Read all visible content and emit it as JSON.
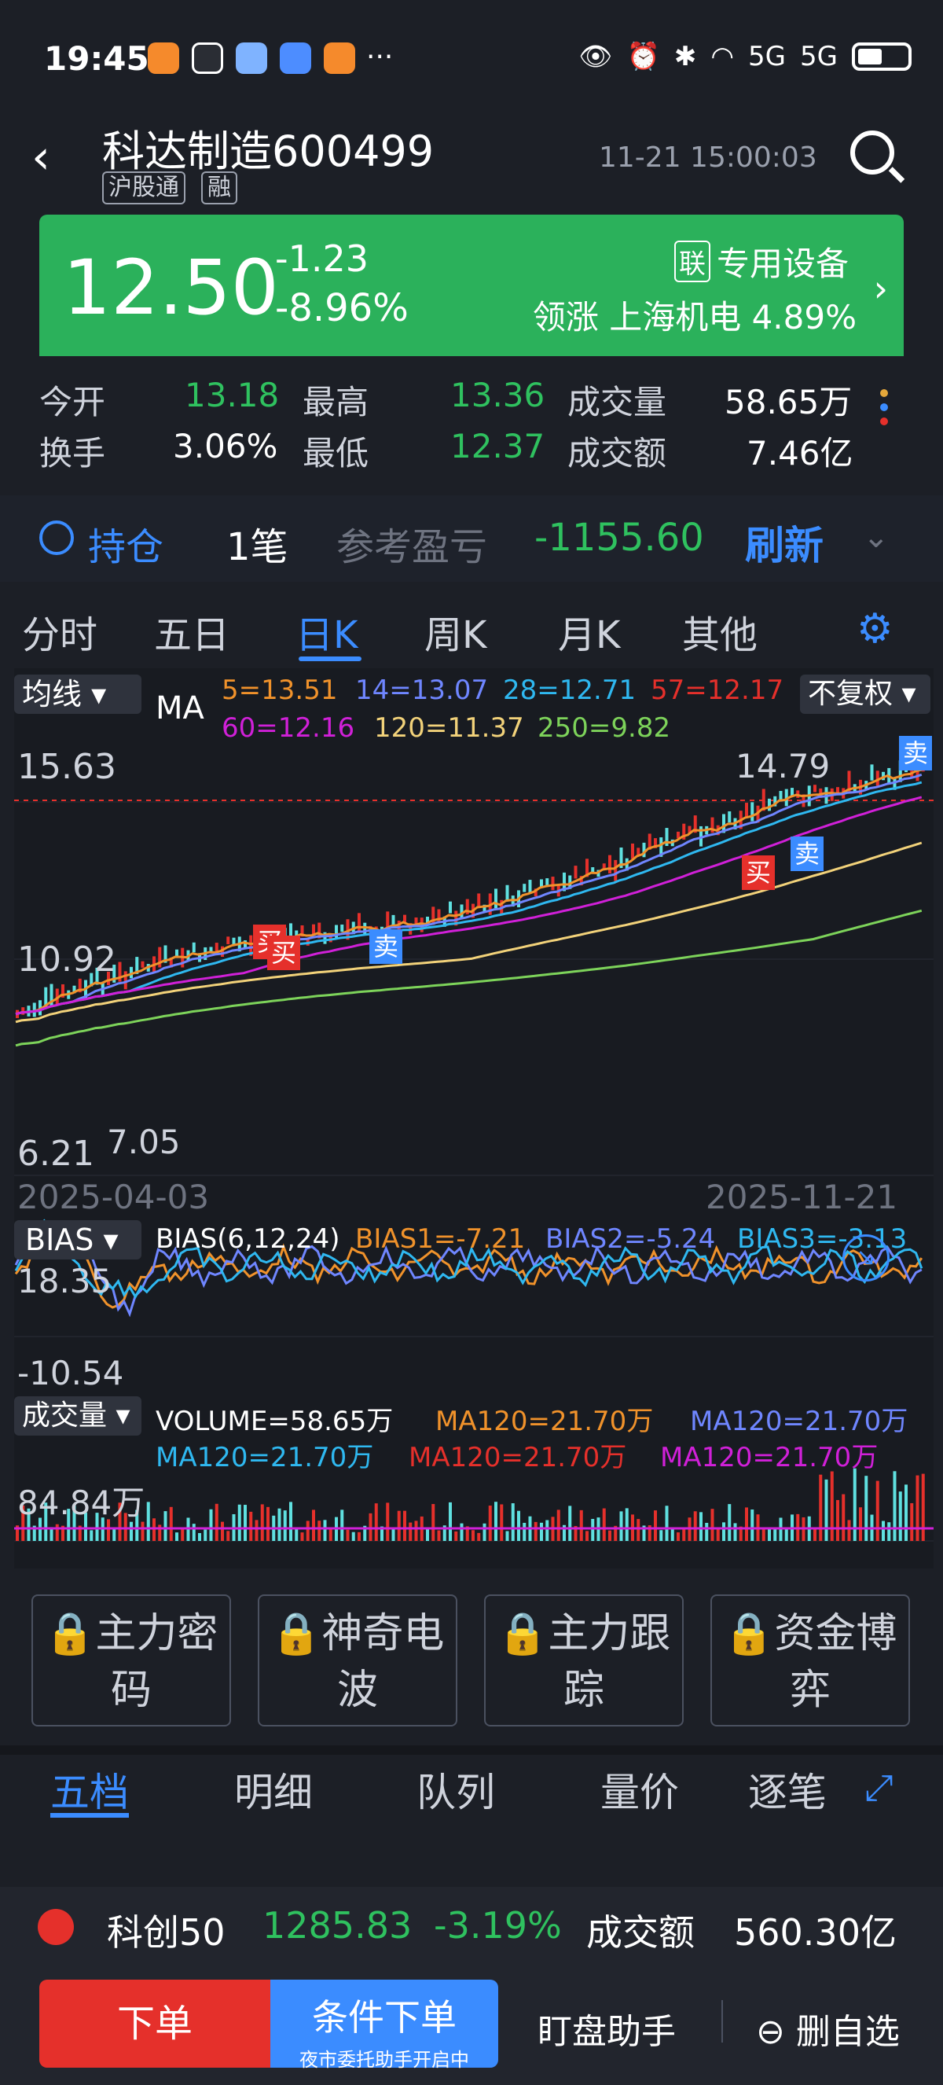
{
  "status": {
    "time": "19:45",
    "net": "5G"
  },
  "header": {
    "name": "科达制造600499",
    "tag1": "沪股通",
    "tag2": "融",
    "datetime": "11-21 15:00:03"
  },
  "quote": {
    "price": "12.50",
    "change": "-1.23",
    "pct": "-8.96%",
    "sector_tag": "联",
    "sector": "专用设备",
    "lead_label": "领涨",
    "lead_stock": "上海机电",
    "lead_pct": "4.89%"
  },
  "stats": [
    {
      "label": "今开",
      "value": "13.18"
    },
    {
      "label": "最高",
      "value": "13.36"
    },
    {
      "label": "成交量",
      "value": "58.65万"
    },
    {
      "label": "换手",
      "value": "3.06%"
    },
    {
      "label": "最低",
      "value": "12.37"
    },
    {
      "label": "成交额",
      "value": "7.46亿"
    }
  ],
  "holding": {
    "label": "持仓",
    "count": "1笔",
    "pl_label": "参考盈亏",
    "pl": "-1155.60",
    "refresh": "刷新"
  },
  "tabs": [
    "分时",
    "五日",
    "日K",
    "周K",
    "月K",
    "其他"
  ],
  "ma": {
    "selector": "均线",
    "label": "MA",
    "fq": "不复权",
    "v": [
      "5=13.51",
      "14=13.07",
      "28=12.71",
      "57=12.17",
      "60=12.16",
      "120=11.37",
      "250=9.82"
    ]
  },
  "kchart": {
    "ymax": "15.63",
    "ymid": "10.92",
    "ymin": "6.21",
    "low_mark": "7.05",
    "high_mark": "14.79",
    "start": "2025-04-03",
    "end": "2025-11-21",
    "buy": "买",
    "sell": "卖"
  },
  "bias": {
    "selector": "BIAS",
    "label": "BIAS(6,12,24)",
    "b1": "BIAS1=-7.21",
    "b2": "BIAS2=-5.24",
    "b3": "BIAS3=-3.13",
    "ymax": "18.35",
    "ymin": "-10.54"
  },
  "vol": {
    "selector": "成交量",
    "label": "VOLUME=58.65万",
    "m1": "MA120=21.70万",
    "m2": "MA120=21.70万",
    "m3": "MA120=21.70万",
    "m4": "MA120=21.70万",
    "m5": "MA120=21.70万",
    "ymax": "84.84万"
  },
  "tools": [
    {
      "l1": "主力密",
      "l2": "码"
    },
    {
      "l1": "神奇电",
      "l2": "波"
    },
    {
      "l1": "主力跟",
      "l2": "踪"
    },
    {
      "l1": "资金博",
      "l2": "弈"
    }
  ],
  "btabs": [
    "五档",
    "明细",
    "队列",
    "量价",
    "逐笔"
  ],
  "index": {
    "name": "科创50",
    "value": "1285.83",
    "pct": "-3.19%",
    "amt_label": "成交额",
    "amt": "560.30亿"
  },
  "actions": {
    "order": "下单",
    "cond": "条件下单",
    "cond_sub": "夜市委托助手开启中",
    "watch": "盯盘助手",
    "remove": "删自选"
  },
  "colors": {
    "up": "#e5302b",
    "down": "#2fc15f",
    "accent": "#3b8cff"
  }
}
